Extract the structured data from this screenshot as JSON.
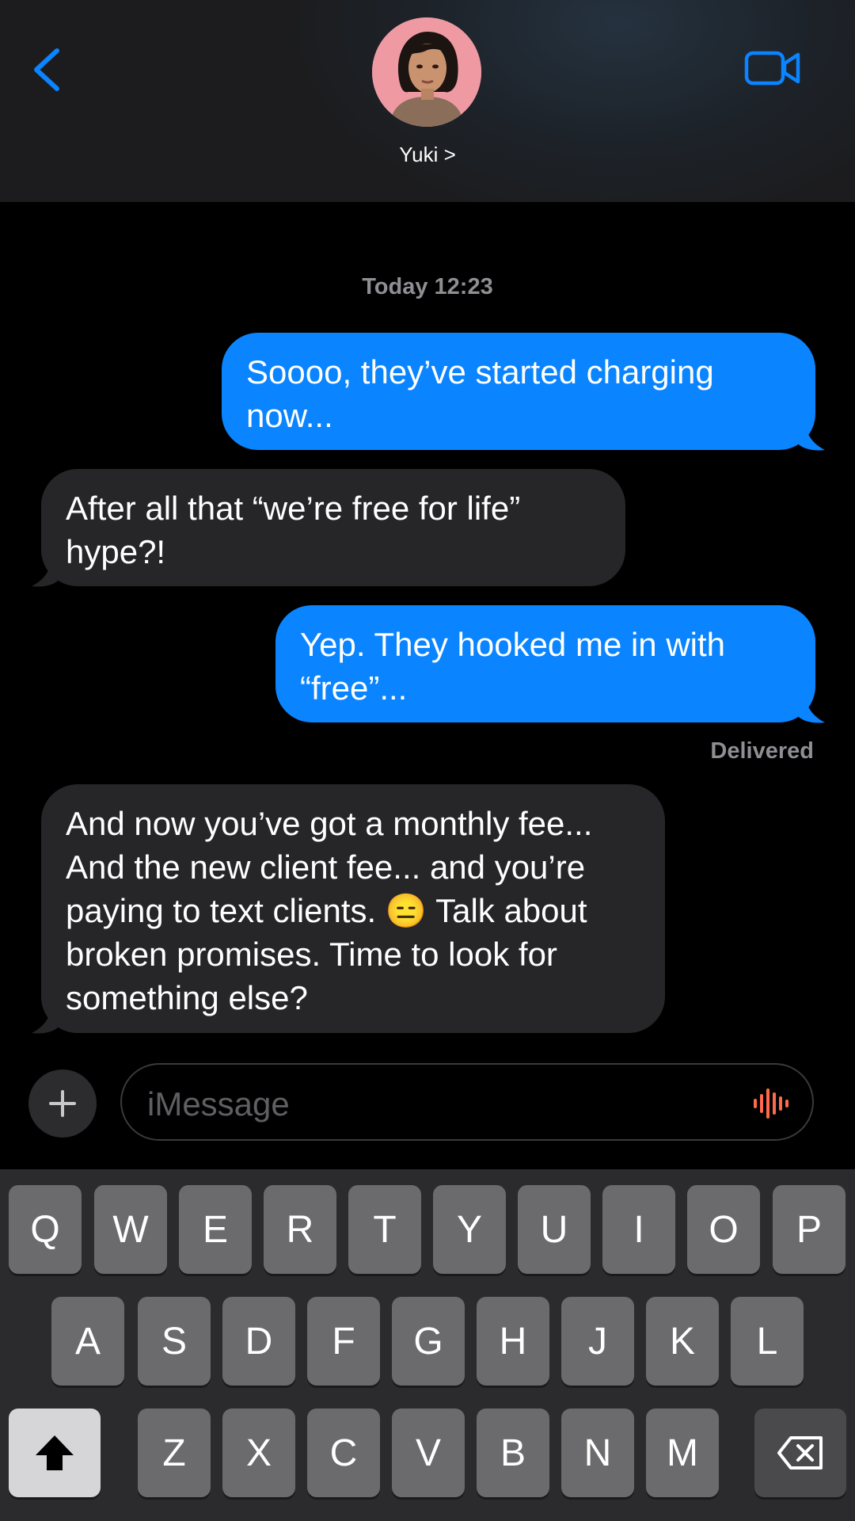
{
  "header": {
    "contact_name": "Yuki >",
    "back_icon": "chevron-left-icon",
    "video_icon": "video-camera-icon",
    "accent": "#0a84ff"
  },
  "conversation": {
    "timestamp": "Today 12:23",
    "messages": [
      {
        "direction": "outgoing",
        "text": "Soooo, they’ve started charging now..."
      },
      {
        "direction": "incoming",
        "text": "After all that “we’re free for life” hype?!"
      },
      {
        "direction": "outgoing",
        "text": "Yep. They hooked me in with “free”..."
      },
      {
        "direction": "incoming",
        "text": "And now you’ve got a monthly fee... And the new client fee... and you’re paying to text clients. 😑 Talk about broken promises. Time to look for something else?"
      }
    ],
    "delivered_status": "Delivered"
  },
  "input": {
    "placeholder": "iMessage",
    "plus_icon": "plus-icon",
    "voice_icon": "waveform-icon",
    "voice_color": "#ff6b4a"
  },
  "keyboard": {
    "row1": [
      "Q",
      "W",
      "E",
      "R",
      "T",
      "Y",
      "U",
      "I",
      "O",
      "P"
    ],
    "row2": [
      "A",
      "S",
      "D",
      "F",
      "G",
      "H",
      "J",
      "K",
      "L"
    ],
    "row3": [
      "Z",
      "X",
      "C",
      "V",
      "B",
      "N",
      "M"
    ],
    "shift_icon": "shift-arrow-icon",
    "delete_icon": "delete-backspace-icon"
  }
}
